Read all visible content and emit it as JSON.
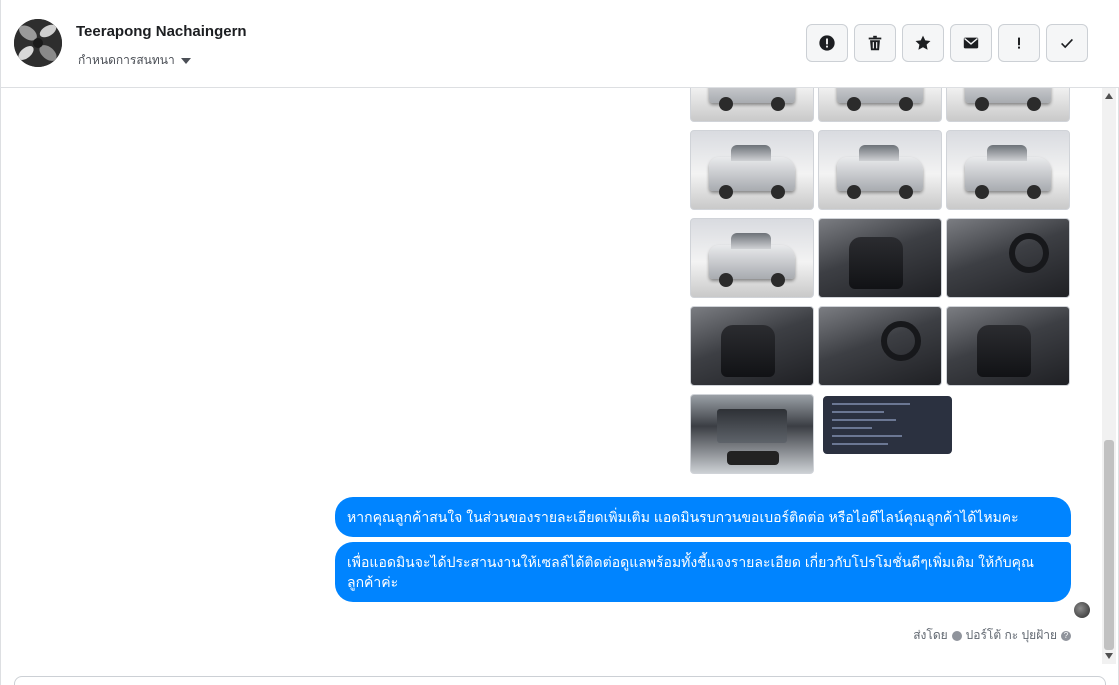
{
  "header": {
    "contact_name": "Teerapong Nachaingern",
    "assign_label": "กำหนดการสนทนา",
    "actions": [
      {
        "name": "report",
        "icon": "exclamation-circle-icon"
      },
      {
        "name": "delete",
        "icon": "trash-icon"
      },
      {
        "name": "star",
        "icon": "star-icon"
      },
      {
        "name": "mark-unread",
        "icon": "envelope-icon"
      },
      {
        "name": "spam",
        "icon": "exclamation-icon"
      },
      {
        "name": "done",
        "icon": "checkmark-icon"
      }
    ]
  },
  "messages": [
    {
      "text": "หากคุณลูกค้าสนใจ ในส่วนของรายละเอียดเพิ่มเติม แอดมินรบกวนขอเบอร์ติดต่อ หรือไอดีไลน์คุณลูกค้าได้ไหมคะ"
    },
    {
      "text": "เพื่อแอดมินจะได้ประสานงานให้เซลล์ได้ติดต่อดูแลพร้อมทั้งชี้แจงรายละเอียด เกี่ยวกับโปรโมชั่นดีๆเพิ่มเติม ให้กับคุณลูกค้าค่ะ"
    }
  ],
  "sent_by": {
    "prefix": "ส่งโดย",
    "name": "ปอร์โต้ กะ ปุยฝ้าย",
    "help": "?"
  },
  "colors": {
    "bubble": "#0084ff",
    "border": "#dddfe2",
    "muted": "#606770"
  }
}
